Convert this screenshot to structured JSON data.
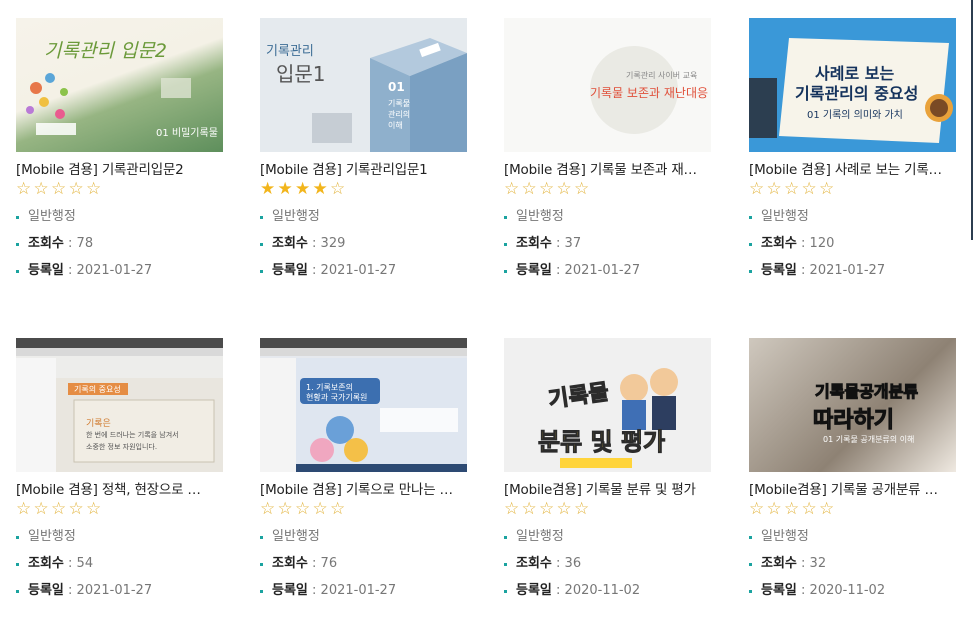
{
  "colors": {
    "accent": "#1ba3a0",
    "star": "#f2b51c"
  },
  "cards": [
    {
      "title": "[Mobile 겸용] 기록관리입문2",
      "rating": 0,
      "category": "일반행정",
      "views_label": "조회수",
      "views": "78",
      "date_label": "등록일",
      "date": "2021-01-27",
      "thumb": {
        "line1": "기록관리 입문2",
        "line2": "01  비밀기록물"
      }
    },
    {
      "title": "[Mobile 겸용] 기록관리입문1",
      "rating": 4,
      "category": "일반행정",
      "views_label": "조회수",
      "views": "329",
      "date_label": "등록일",
      "date": "2021-01-27",
      "thumb": {
        "line1": "기록관리",
        "line2": "입문1",
        "line3": "01",
        "line4": "기록물관리의 이해"
      }
    },
    {
      "title": "[Mobile 겸용] 기록물 보존과 재…",
      "rating": 0,
      "category": "일반행정",
      "views_label": "조회수",
      "views": "37",
      "date_label": "등록일",
      "date": "2021-01-27",
      "thumb": {
        "line1": "기록관리 사이버 교육",
        "line2": "기록물 보존과 재난대응"
      }
    },
    {
      "title": "[Mobile 겸용] 사례로 보는 기록…",
      "rating": 0,
      "category": "일반행정",
      "views_label": "조회수",
      "views": "120",
      "date_label": "등록일",
      "date": "2021-01-27",
      "thumb": {
        "line1": "사례로 보는",
        "line2": "기록관리의 중요성",
        "line3": "01  기록의 의미와 가치"
      }
    },
    {
      "title": "[Mobile 겸용] 정책, 현장으로 …",
      "rating": 0,
      "category": "일반행정",
      "views_label": "조회수",
      "views": "54",
      "date_label": "등록일",
      "date": "2021-01-27",
      "thumb": {
        "line1": "기록의 중요성",
        "line2": "기록은",
        "line3": "한 번에 드러나는 기록을 남겨서",
        "line4": "소중한 정보 자원입니다."
      }
    },
    {
      "title": "[Mobile 겸용] 기록으로 만나는 …",
      "rating": 0,
      "category": "일반행정",
      "views_label": "조회수",
      "views": "76",
      "date_label": "등록일",
      "date": "2021-01-27",
      "thumb": {
        "line1": "1. 기록보존의",
        "line2": "현황과 국가기록원"
      }
    },
    {
      "title": "[Mobile겸용] 기록물 분류 및 평가",
      "rating": 0,
      "category": "일반행정",
      "views_label": "조회수",
      "views": "36",
      "date_label": "등록일",
      "date": "2020-11-02",
      "thumb": {
        "line1": "기록물",
        "line2": "분류 및 평가"
      }
    },
    {
      "title": "[Mobile겸용] 기록물 공개분류 …",
      "rating": 0,
      "category": "일반행정",
      "views_label": "조회수",
      "views": "32",
      "date_label": "등록일",
      "date": "2020-11-02",
      "thumb": {
        "line1": "기록물공개분류",
        "line2": "따라하기",
        "line3": "01  기록물 공개분류의 이해"
      }
    }
  ]
}
